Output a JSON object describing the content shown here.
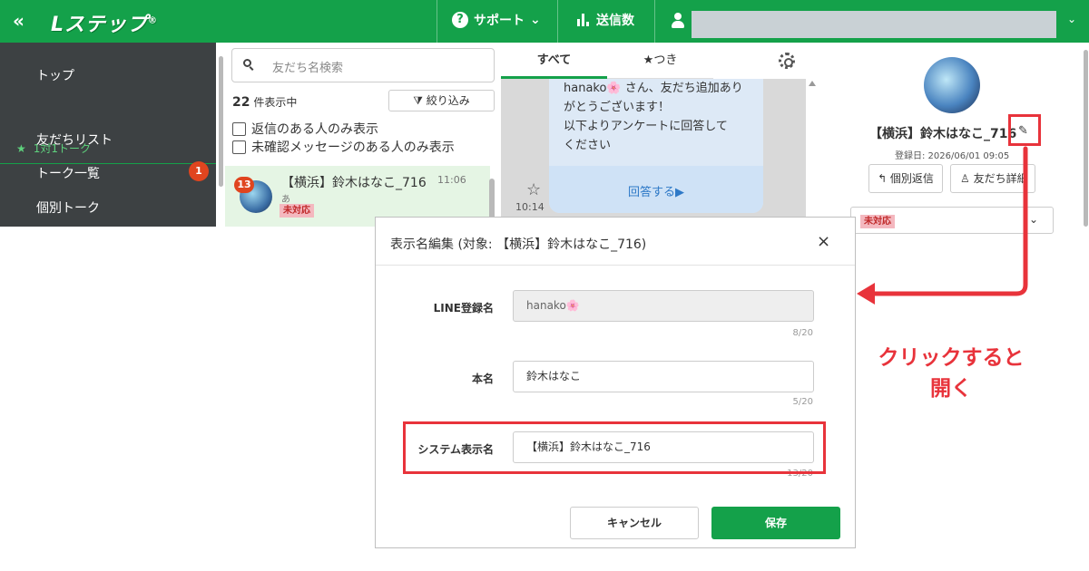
{
  "header": {
    "collapse_glyph": "«",
    "logo": "Lステップ",
    "logo_mark": "®",
    "support_label": "サポート",
    "support_icon": "question-circle-icon",
    "support_caret": "⌄",
    "send_count_label": "送信数",
    "user_caret": "⌄"
  },
  "nav": {
    "items": [
      {
        "label": "トップ"
      },
      {
        "label": "友だちリスト"
      },
      {
        "label": "トーク一覧"
      },
      {
        "label": "個別トーク"
      }
    ],
    "sub_item": "1対1トーク",
    "sub_star": "★",
    "badge": "1"
  },
  "friend_list": {
    "search_placeholder": "友だち名検索",
    "count_number": "22",
    "count_suffix": "件表示中",
    "filter_label": "絞り込み",
    "filter_icon": "filter-icon",
    "checkbox_reply": "返信のある人のみ表示",
    "checkbox_unread": "未確認メッセージのある人のみ表示",
    "row": {
      "unread": "13",
      "name": "【横浜】鈴木はなこ_716",
      "time": "11:06",
      "preview": "あ",
      "tag": "未対応"
    }
  },
  "chat": {
    "tab_all": "すべて",
    "tab_star": "★つき",
    "bubble_lines": [
      "hanako🌸 さん、友だち追加あり",
      "がとうございます！",
      "以下よりアンケートに回答して",
      "ください"
    ],
    "action": "回答する▶",
    "star": "☆",
    "time": "10:14"
  },
  "profile": {
    "name": "【横浜】鈴木はなこ_716",
    "edit_icon": "✎",
    "registered": "登録日: 2026/06/01 09:05",
    "reply_button": "↰ 個別返信",
    "detail_button": "♙ 友だち詳細",
    "status_tag": "未対応",
    "status_caret": "⌄"
  },
  "modal": {
    "title": "表示名編集 (対象: 【横浜】鈴木はなこ_716)",
    "close": "×",
    "line_name_label": "LINE登録名",
    "line_name_value": "hanako🌸",
    "line_name_count": "8/20",
    "real_name_label": "本名",
    "real_name_value": "鈴木はなこ",
    "real_name_count": "5/20",
    "system_name_label": "システム表示名",
    "system_name_value": "【横浜】鈴木はなこ_716",
    "system_name_count": "13/20",
    "cancel": "キャンセル",
    "save": "保存"
  },
  "annotation": {
    "line1": "クリックすると",
    "line2": "開く",
    "color": "#e8333b"
  },
  "colors": {
    "brand_green": "#14a14a",
    "nav_dark": "#3d4143",
    "badge_red": "#e0451f",
    "highlight_red": "#e8333b"
  }
}
